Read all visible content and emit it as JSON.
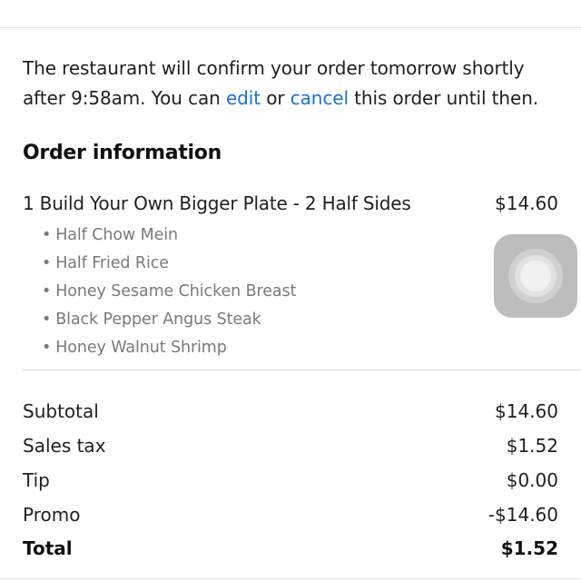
{
  "confirmation": {
    "text_before": "The restaurant will confirm your order tomorrow shortly after 9:58am. You can ",
    "edit_link": "edit",
    "text_middle": " or ",
    "cancel_link": "cancel",
    "text_after": " this order until then."
  },
  "order": {
    "section_title": "Order information",
    "item": {
      "name": "1 Build Your Own Bigger Plate - 2 Half Sides",
      "price": "$14.60",
      "modifiers": [
        "Half Chow Mein",
        "Half Fried Rice",
        "Honey Sesame Chicken Breast",
        "Black Pepper Angus Steak",
        "Honey Walnut Shrimp"
      ]
    }
  },
  "summary": {
    "subtotal": {
      "label": "Subtotal",
      "value": "$14.60"
    },
    "sales_tax": {
      "label": "Sales tax",
      "value": "$1.52"
    },
    "tip": {
      "label": "Tip",
      "value": "$0.00"
    },
    "promo": {
      "label": "Promo",
      "value": "-$14.60"
    },
    "total": {
      "label": "Total",
      "value": "$1.52"
    }
  },
  "overlay": {
    "icon": "assistive-touch-icon"
  },
  "colors": {
    "link": "#1a6fd6",
    "muted_text": "#7a7a7a",
    "divider": "#dcdcdc"
  }
}
